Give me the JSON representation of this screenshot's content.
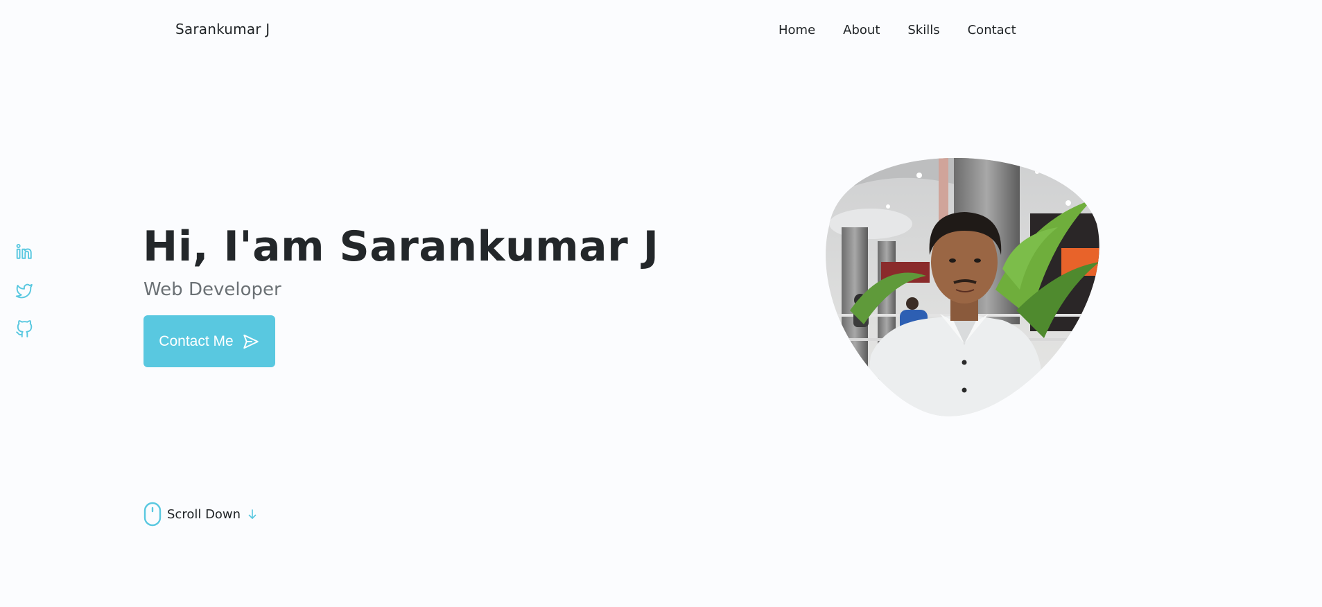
{
  "header": {
    "logo_text": "Sarankumar J",
    "nav": [
      {
        "label": "Home"
      },
      {
        "label": "About"
      },
      {
        "label": "Skills"
      },
      {
        "label": "Contact"
      }
    ]
  },
  "social": [
    {
      "icon": "linkedin-icon"
    },
    {
      "icon": "twitter-icon"
    },
    {
      "icon": "github-icon"
    }
  ],
  "hero": {
    "title": "Hi, I'am Sarankumar J",
    "subtitle": "Web Developer",
    "cta_label": "Contact Me",
    "cta_icon": "send-icon"
  },
  "scroll": {
    "label": "Scroll Down",
    "mouse_icon": "mouse-icon",
    "arrow_icon": "arrow-down-icon"
  },
  "portrait": {
    "alt": "Profile photo",
    "shape": "blob"
  },
  "colors": {
    "background": "#fbfcfe",
    "accent": "#59c8e0",
    "text": "#1f2326",
    "muted": "#6b7175"
  }
}
